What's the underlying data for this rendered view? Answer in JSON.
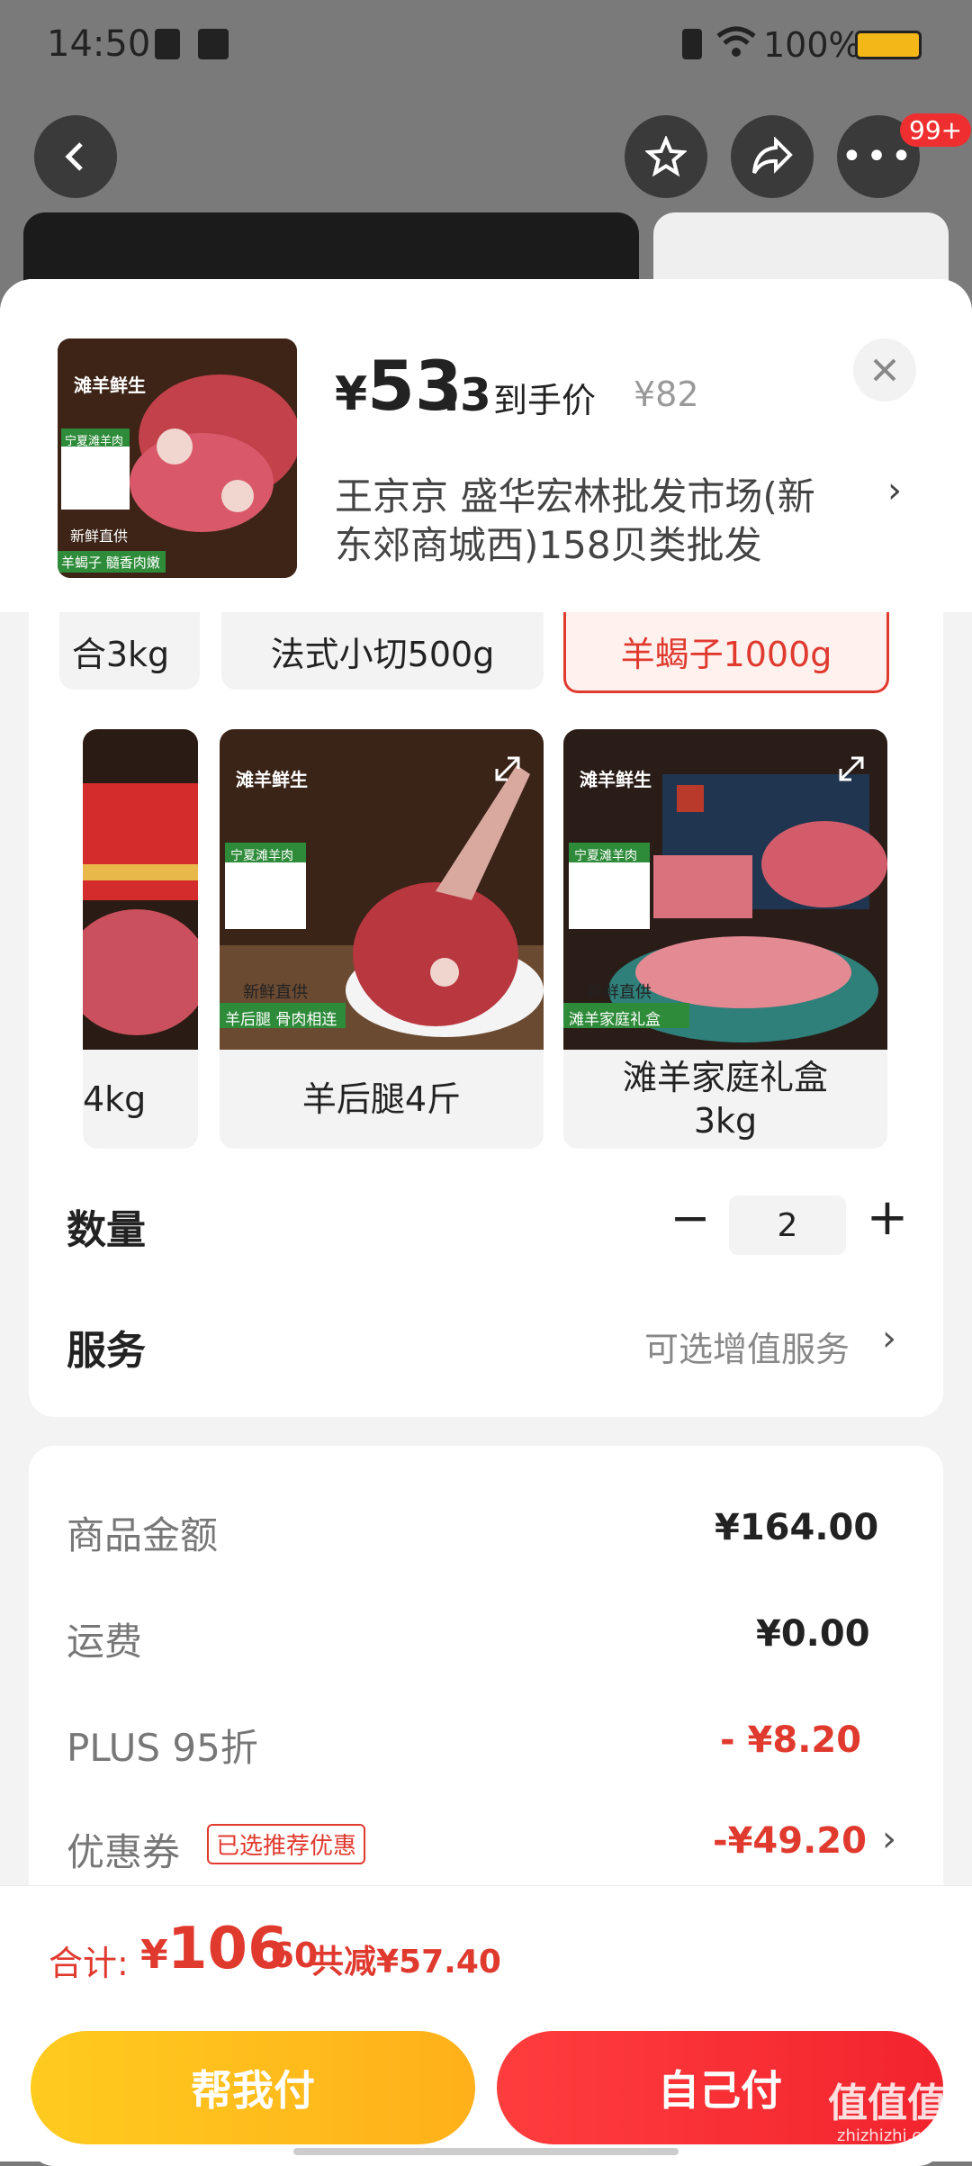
{
  "status_bar": {
    "time": "14:50",
    "battery": "100%"
  },
  "header": {
    "badge": "99+"
  },
  "product": {
    "thumb_brand": "滩羊鲜生",
    "thumb_tag1": "宁夏滩羊肉",
    "thumb_tag2": "新鲜直供",
    "thumb_tag3": "羊蝎子 髓香肉嫩",
    "price_yen": "¥",
    "price_int": "53",
    "price_dec": ".3",
    "price_note": "到手价",
    "original_price": "¥82",
    "shop_line1": "王京京  盛华宏林批发市场(新",
    "shop_line2": "东郊商城西)158贝类批发"
  },
  "variant_chips": [
    "合3kg",
    "法式小切500g",
    "羊蝎子1000g"
  ],
  "variant_cards": [
    {
      "label": "4kg",
      "badge1": "",
      "badge2": ""
    },
    {
      "label": "羊后腿4斤",
      "badge1": "新鲜直供",
      "badge2": "羊后腿  骨肉相连",
      "brand": "滩羊鲜生",
      "tag": "宁夏滩羊肉"
    },
    {
      "label": "滩羊家庭礼盒\n3kg",
      "badge1": "新鲜直供",
      "badge2": "滩羊家庭礼盒",
      "brand": "滩羊鲜生",
      "tag": "宁夏滩羊肉"
    }
  ],
  "quantity": {
    "label": "数量",
    "value": "2",
    "minus": "−",
    "plus": "+"
  },
  "service": {
    "label": "服务",
    "value": "可选增值服务"
  },
  "summary": {
    "goods_label": "商品金额",
    "goods_value": "¥164.00",
    "shipping_label": "运费",
    "shipping_value": "¥0.00",
    "plus_label": "PLUS 95折",
    "plus_value": "- ¥8.20",
    "coupon_label": "优惠券",
    "coupon_tag": "已选推荐优惠",
    "coupon_value": "-¥49.20"
  },
  "footer": {
    "total_label": "合计:",
    "total_yen": "¥",
    "total_int": "106",
    "total_dec": ".60",
    "total_save": "共减¥57.40",
    "help_pay": "帮我付",
    "self_pay": "自己付"
  },
  "watermark": {
    "text": "值值值",
    "url": "zhizhizhi.com"
  },
  "colors": {
    "accent_red": "#e03a2f",
    "help_pay": "#ffb81c",
    "self_pay": "#f52b35"
  }
}
